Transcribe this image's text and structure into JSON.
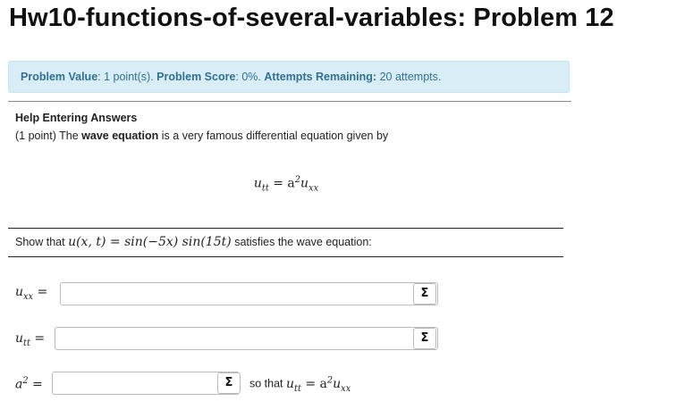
{
  "page": {
    "title": "Hw10-functions-of-several-variables: Problem 12"
  },
  "info": {
    "value_label": "Problem Value",
    "value_text": ": 1 point(s).",
    "score_label": "Problem Score",
    "score_text": ": 0%.",
    "attempts_label": "Attempts Remaining:",
    "attempts_text": "20 attempts."
  },
  "problem": {
    "help_link": "Help Entering Answers",
    "intro_prefix": "(1 point) The",
    "intro_bold": "wave equation",
    "intro_suffix": "is a very famous differential equation given by",
    "equation_lhs": "u",
    "equation_lhs_sub": "tt",
    "equation_eq": " = a",
    "equation_sup": "2",
    "equation_rhs": "u",
    "equation_rhs_sub": "xx",
    "show_prefix": "Show that",
    "show_math": "u(x, t) = sin(−5x) sin(15t)",
    "show_suffix": "satisfies the wave equation:"
  },
  "answers": {
    "uxx_label": "u",
    "uxx_sub": "xx",
    "utt_label": "u",
    "utt_sub": "tt",
    "a2_label": "a",
    "a2_sup": "2",
    "equals": " =",
    "uxx_value": "",
    "utt_value": "",
    "a2_value": "",
    "sigma": "Σ",
    "so_that_text": "so that",
    "so_that_lhs": "u",
    "so_that_lhs_sub": "tt",
    "so_that_eq": " = a",
    "so_that_sup": "2",
    "so_that_rhs": "u",
    "so_that_rhs_sub": "xx"
  }
}
